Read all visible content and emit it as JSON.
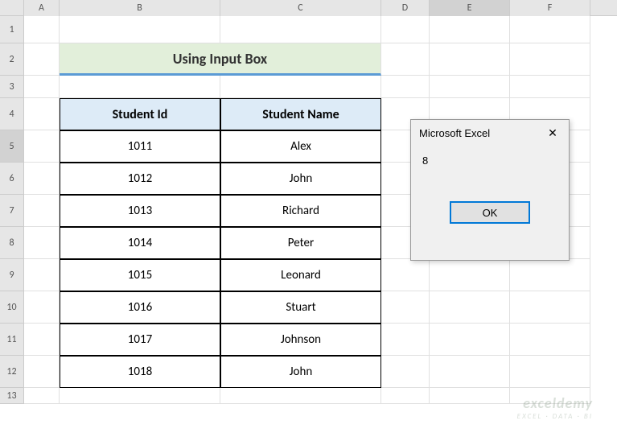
{
  "columns": [
    "A",
    "B",
    "C",
    "D",
    "E",
    "F"
  ],
  "selected_column": "E",
  "selected_row": 5,
  "title": "Using Input Box",
  "table": {
    "headers": [
      "Student Id",
      "Student Name"
    ],
    "rows": [
      {
        "id": "1011",
        "name": "Alex"
      },
      {
        "id": "1012",
        "name": "John"
      },
      {
        "id": "1013",
        "name": "Richard"
      },
      {
        "id": "1014",
        "name": "Peter"
      },
      {
        "id": "1015",
        "name": "Leonard"
      },
      {
        "id": "1016",
        "name": "Stuart"
      },
      {
        "id": "1017",
        "name": "Johnson"
      },
      {
        "id": "1018",
        "name": "John"
      }
    ]
  },
  "dialog": {
    "title": "Microsoft Excel",
    "close": "✕",
    "message": "8",
    "ok": "OK"
  },
  "watermark": {
    "main": "exceldemy",
    "sub": "EXCEL · DATA · BI"
  }
}
